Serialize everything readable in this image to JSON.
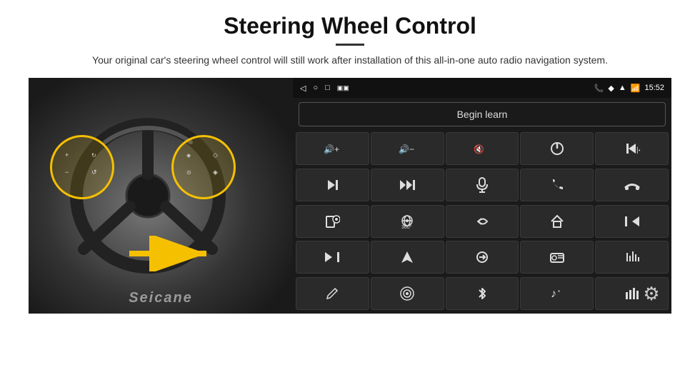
{
  "header": {
    "title": "Steering Wheel Control",
    "subtitle": "Your original car's steering wheel control will still work after installation of this all-in-one auto radio navigation system."
  },
  "status_bar": {
    "time": "15:52",
    "nav_icons": [
      "◁",
      "○",
      "□",
      "▣▣"
    ],
    "right_icons": [
      "📞",
      "◆",
      "▲",
      "📶"
    ]
  },
  "begin_learn": {
    "label": "Begin learn"
  },
  "seicane": {
    "label": "Seicane"
  },
  "settings": {
    "icon": "⚙"
  },
  "controls": [
    {
      "icon": "🔊+",
      "label": "vol-up"
    },
    {
      "icon": "🔊−",
      "label": "vol-down"
    },
    {
      "icon": "🔇",
      "label": "mute"
    },
    {
      "icon": "⏻",
      "label": "power"
    },
    {
      "icon": "⏮",
      "label": "prev-track"
    },
    {
      "icon": "⏭",
      "label": "next"
    },
    {
      "icon": "⏭⏭",
      "label": "fwd"
    },
    {
      "icon": "🎤",
      "label": "mic"
    },
    {
      "icon": "📞",
      "label": "phone"
    },
    {
      "icon": "↩",
      "label": "hang-up"
    },
    {
      "icon": "📱",
      "label": "screen"
    },
    {
      "icon": "👁360",
      "label": "360-view"
    },
    {
      "icon": "↺",
      "label": "back"
    },
    {
      "icon": "🏠",
      "label": "home"
    },
    {
      "icon": "⏮⏮",
      "label": "rew"
    },
    {
      "icon": "⏭⏭",
      "label": "skip-fwd"
    },
    {
      "icon": "➤",
      "label": "navigate"
    },
    {
      "icon": "⇄",
      "label": "switch"
    },
    {
      "icon": "📻",
      "label": "radio"
    },
    {
      "icon": "≡|",
      "label": "equalizer"
    },
    {
      "icon": "✏",
      "label": "edit"
    },
    {
      "icon": "⭕",
      "label": "target"
    },
    {
      "icon": "✱",
      "label": "bluetooth"
    },
    {
      "icon": "🎵",
      "label": "music"
    },
    {
      "icon": "📊",
      "label": "spectrum"
    }
  ]
}
